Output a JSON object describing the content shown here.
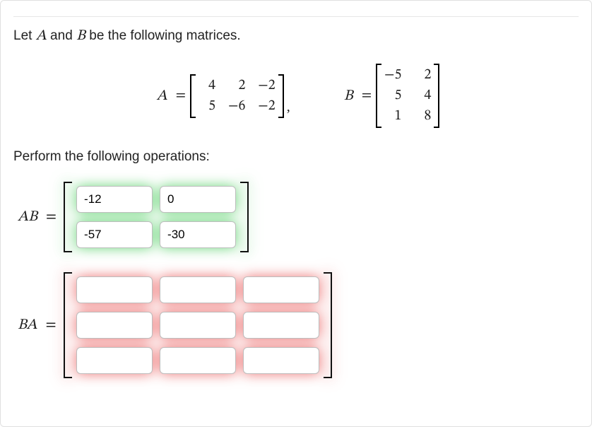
{
  "intro": {
    "pre": "Let ",
    "A": "A",
    "mid": " and ",
    "B": "B",
    "post": " be the following matrices."
  },
  "matrices": {
    "A": {
      "label": "A",
      "eq": "=",
      "rows": [
        [
          "4",
          "2",
          "−2"
        ],
        [
          "5",
          "−6",
          "−2"
        ]
      ],
      "after": ","
    },
    "B": {
      "label": "B",
      "eq": "=",
      "rows": [
        [
          "−5",
          "2"
        ],
        [
          "5",
          "4"
        ],
        [
          "1",
          "8"
        ]
      ]
    }
  },
  "perform": "Perform the following operations:",
  "products": {
    "AB": {
      "label": "AB",
      "eq": "=",
      "rows": 2,
      "cols": 2,
      "values": [
        [
          "-12",
          "0"
        ],
        [
          "-57",
          "-30"
        ]
      ],
      "state": "correct"
    },
    "BA": {
      "label": "BA",
      "eq": "=",
      "rows": 3,
      "cols": 3,
      "values": [
        [
          "",
          "",
          ""
        ],
        [
          "",
          "",
          ""
        ],
        [
          "",
          "",
          ""
        ]
      ],
      "state": "incorrect"
    }
  }
}
